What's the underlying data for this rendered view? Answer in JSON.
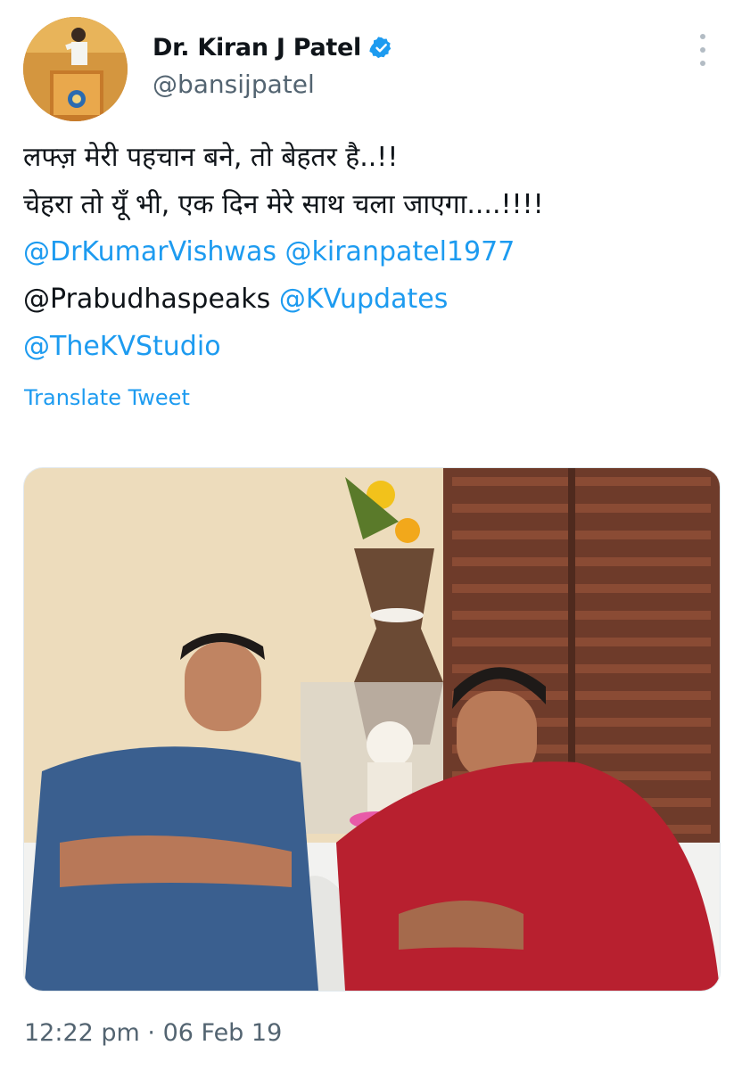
{
  "author": {
    "name": "Dr. Kiran J Patel",
    "handle": "@bansijpatel",
    "verified_icon": "verified-badge-icon",
    "accent_color": "#1d9bf0"
  },
  "tweet": {
    "line1": "लफ्ज़ मेरी पहचान बने, तो बेहतर है..!!",
    "line2": "चेहरा तो यूँ भी, एक दिन मेरे साथ चला जाएगा....!!!!",
    "mentions": {
      "m1": "@DrKumarVishwas",
      "m2": "@kiranpatel1977",
      "m3": "@Prabudhaspeaks",
      "m4": "@KVupdates",
      "m5": "@TheKVStudio"
    }
  },
  "translate_label": "Translate Tweet",
  "timestamp": "12:22 pm · 06 Feb 19",
  "more_icon": "more-vertical-icon"
}
